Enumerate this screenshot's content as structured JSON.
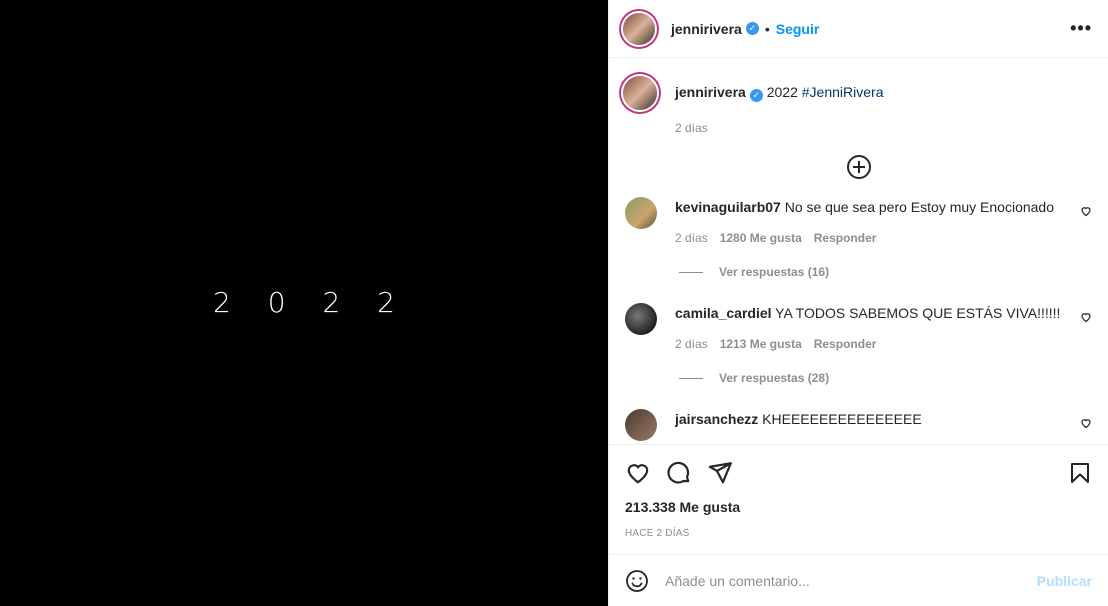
{
  "media": {
    "text": "2 0 2 2"
  },
  "header": {
    "username": "jennirivera",
    "verified_mark": "✓",
    "dot": "•",
    "follow_label": "Seguir",
    "more_label": "•••"
  },
  "caption": {
    "username": "jennirivera",
    "text_prefix": "2022",
    "hashtag": "#JenniRivera",
    "time": "2 días"
  },
  "comments": [
    {
      "username": "kevinaguilarb07",
      "text": "No se que sea pero Estoy muy Enocionado",
      "time": "2 días",
      "likes": "1280 Me gusta",
      "reply": "Responder",
      "replies": "Ver respuestas (16)"
    },
    {
      "username": "camila_cardiel",
      "text": "YA TODOS SABEMOS QUE ESTÁS VIVA!!!!!!",
      "time": "2 días",
      "likes": "1213 Me gusta",
      "reply": "Responder",
      "replies": "Ver respuestas (28)"
    },
    {
      "username": "jairsanchezz",
      "text": "KHEEEEEEEEEEEEEEE"
    }
  ],
  "footer": {
    "likes": "213.338 Me gusta",
    "posted": "HACE 2 DÍAS"
  },
  "add_comment": {
    "placeholder": "Añade un comentario...",
    "post_label": "Publicar"
  },
  "colors": {
    "link": "#0095f6",
    "verified": "#3897f0",
    "hashtag": "#00376b",
    "muted": "#8e8e8e",
    "post_disabled": "#b2dffc"
  },
  "icons": [
    "heart-icon",
    "comment-icon",
    "share-icon",
    "bookmark-icon",
    "emoji-icon",
    "plus-circle-icon",
    "more-icon",
    "verified-icon"
  ]
}
